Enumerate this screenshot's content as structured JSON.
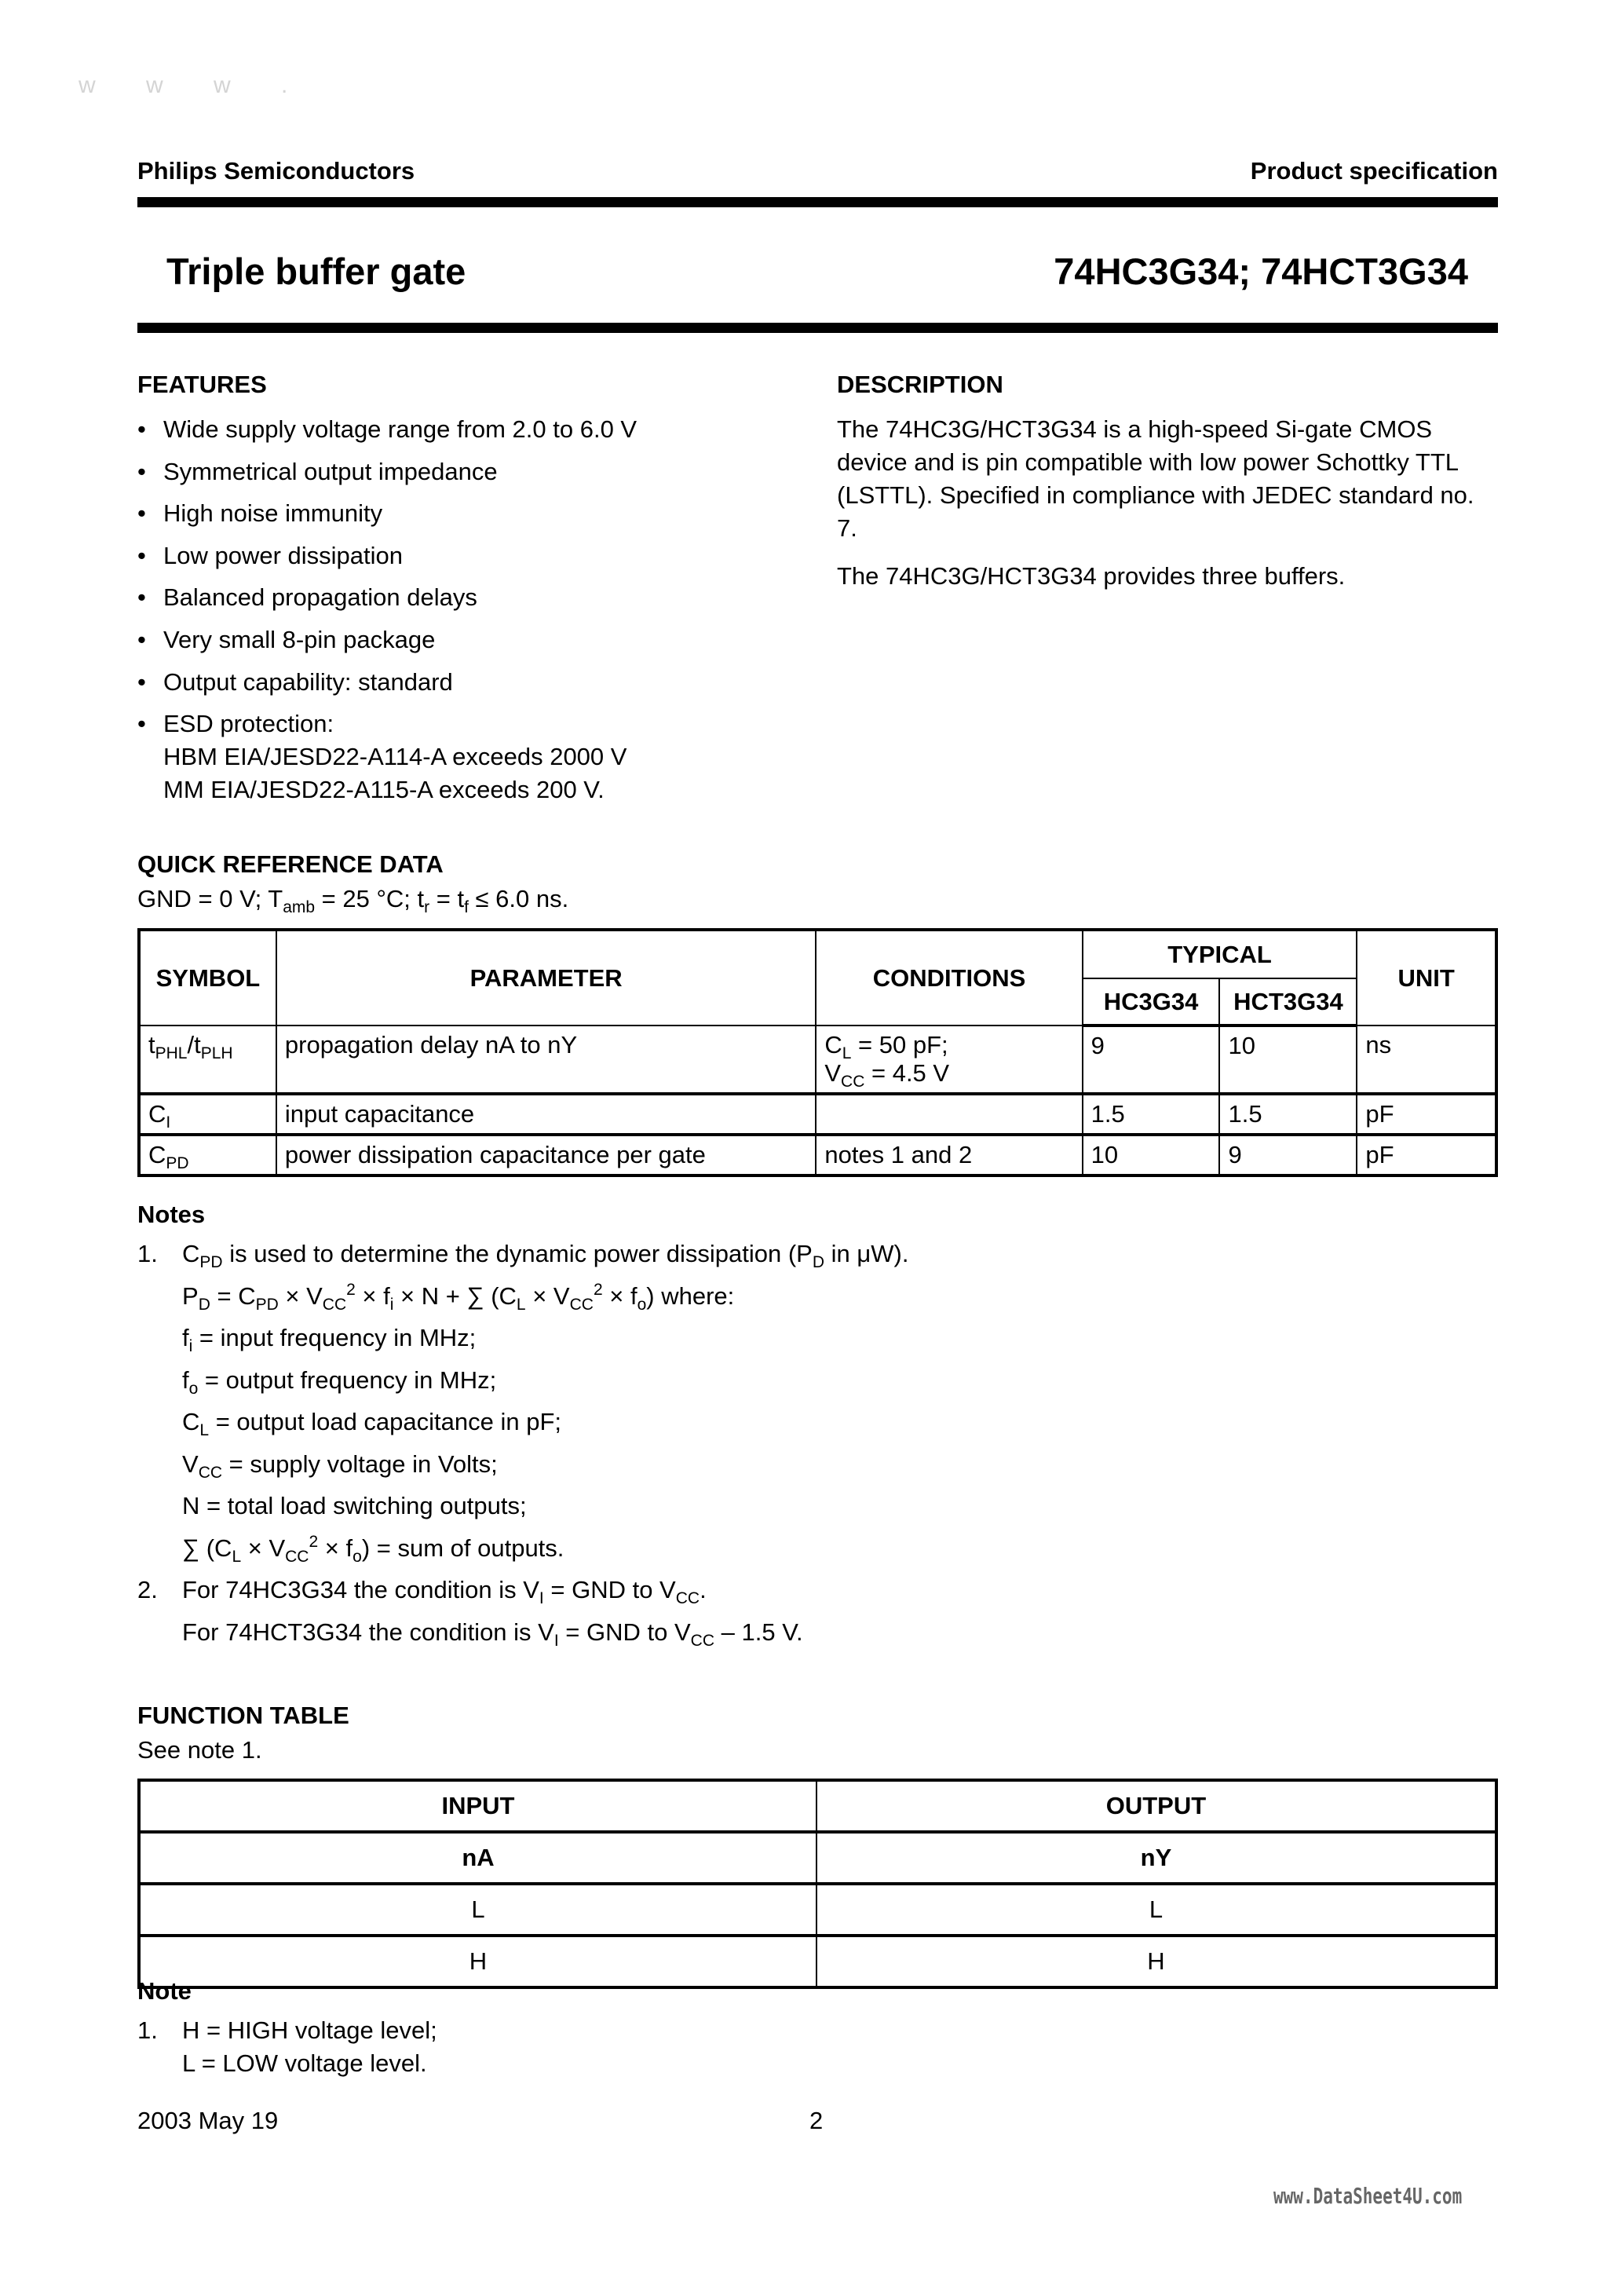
{
  "watermark_top": [
    "w",
    "w",
    "w",
    "."
  ],
  "header": {
    "company": "Philips Semiconductors",
    "doc_type": "Product specification",
    "title": "Triple buffer gate",
    "part_numbers": "74HC3G34; 74HCT3G34"
  },
  "features": {
    "heading": "FEATURES",
    "bullet": "•",
    "items": [
      "Wide supply voltage range from 2.0 to 6.0 V",
      "Symmetrical output impedance",
      "High noise immunity",
      "Low power dissipation",
      "Balanced propagation delays",
      "Very small 8-pin package",
      "Output capability: standard",
      "ESD protection:"
    ],
    "esd_lines": [
      "HBM EIA/JESD22-A114-A exceeds 2000 V",
      "MM EIA/JESD22-A115-A exceeds 200 V."
    ]
  },
  "description": {
    "heading": "DESCRIPTION",
    "paragraphs": [
      "The 74HC3G/HCT3G34 is a high-speed Si-gate CMOS device and is pin compatible with low power Schottky TTL (LSTTL). Specified in compliance with JEDEC standard no. 7.",
      "The 74HC3G/HCT3G34 provides three buffers."
    ]
  },
  "quick_reference": {
    "heading": "QUICK REFERENCE DATA",
    "conditions": {
      "gnd": "GND = 0 V; T",
      "tamb_sub": "amb",
      "temp": " = 25 °C; t",
      "tr_sub": "r",
      "eq": " = t",
      "tf_sub": "f",
      "rest": " ≤ 6.0 ns."
    },
    "columns": {
      "symbol": "SYMBOL",
      "parameter": "PARAMETER",
      "conditions": "CONDITIONS",
      "typical": "TYPICAL",
      "hc": "HC3G34",
      "hct": "HCT3G34",
      "unit": "UNIT"
    },
    "rows": [
      {
        "symbol_a": "t",
        "symbol_a_sub": "PHL",
        "symbol_sep": "/t",
        "symbol_b_sub": "PLH",
        "parameter": "propagation delay nA to nY",
        "cond_line1_base": "C",
        "cond_line1_sub": "L",
        "cond_line1_rest": " = 50 pF;",
        "cond_line2_base": "V",
        "cond_line2_sub": "CC",
        "cond_line2_rest": " = 4.5 V",
        "hc": "9",
        "hct": "10",
        "unit": "ns"
      },
      {
        "symbol_a": "C",
        "symbol_a_sub": "I",
        "parameter": "input capacitance",
        "conditions": "",
        "hc": "1.5",
        "hct": "1.5",
        "unit": "pF"
      },
      {
        "symbol_a": "C",
        "symbol_a_sub": "PD",
        "parameter": "power dissipation capacitance per gate",
        "conditions": "notes 1 and 2",
        "hc": "10",
        "hct": "9",
        "unit": "pF"
      }
    ]
  },
  "notes": {
    "heading": "Notes",
    "n1_num": "1.",
    "n2_num": "2.",
    "n1_l1": [
      "C",
      "PD",
      " is used to determine the dynamic power dissipation (P",
      "D",
      " in μW)."
    ],
    "n1_l2": [
      "P",
      "D",
      " = C",
      "PD",
      " × V",
      "CC",
      "2",
      " × f",
      "i",
      " × N + ∑ (C",
      "L",
      " × V",
      "CC",
      "2",
      " × f",
      "o",
      ") where:"
    ],
    "n1_l3": [
      "f",
      "i",
      " = input frequency in MHz;"
    ],
    "n1_l4": [
      "f",
      "o",
      " = output frequency in MHz;"
    ],
    "n1_l5": [
      "C",
      "L",
      " = output load capacitance in pF;"
    ],
    "n1_l6": [
      "V",
      "CC",
      " = supply voltage in Volts;"
    ],
    "n1_l7": "N = total load switching outputs;",
    "n1_l8": [
      "∑ (C",
      "L",
      " × V",
      "CC",
      "2",
      " × f",
      "o",
      ") = sum of outputs."
    ],
    "n2_l1": [
      "For 74HC3G34 the condition is V",
      "I",
      " = GND to V",
      "CC",
      "."
    ],
    "n2_l2": [
      "For 74HCT3G34 the condition is V",
      "I",
      " = GND to V",
      "CC",
      " – 1.5 V."
    ]
  },
  "function_table": {
    "heading": "FUNCTION TABLE",
    "subtitle": "See note 1.",
    "header_input": "INPUT",
    "header_output": "OUTPUT",
    "sub_input": "nA",
    "sub_output": "nY",
    "rows": [
      {
        "input": "L",
        "output": "L"
      },
      {
        "input": "H",
        "output": "H"
      }
    ]
  },
  "note_single": {
    "heading": "Note",
    "num": "1.",
    "line1": "H = HIGH voltage level;",
    "line2": "L = LOW voltage level."
  },
  "footer": {
    "date": "2003 May 19",
    "page": "2",
    "watermark": "www.DataSheet4U.com"
  }
}
